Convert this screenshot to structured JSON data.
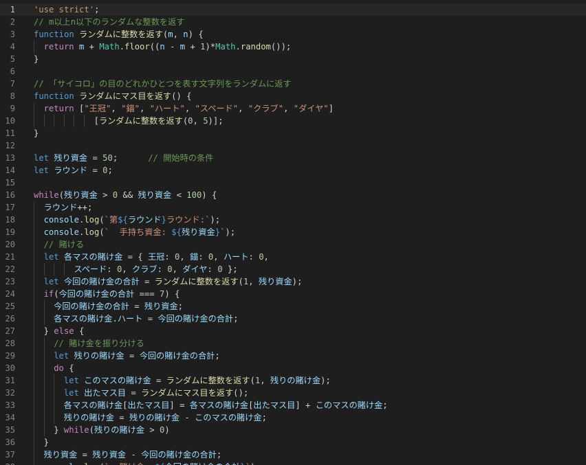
{
  "editor": {
    "active_line": 1,
    "colors": {
      "background": "#1e1e1e",
      "keyword": "#569cd6",
      "control": "#c586c0",
      "string": "#ce9178",
      "comment": "#6a9955",
      "number": "#b5cea8",
      "function": "#dcdcaa",
      "variable": "#9cdcfe",
      "class": "#4ec9b0",
      "punctuation": "#d4d4d4"
    },
    "lines": [
      {
        "n": "1",
        "indent": 0,
        "tokens": [
          [
            "str",
            "'use strict'"
          ],
          [
            "p",
            ";"
          ]
        ]
      },
      {
        "n": "2",
        "indent": 0,
        "tokens": [
          [
            "cmt",
            "// m以上n以下のランダムな整数を返す"
          ]
        ]
      },
      {
        "n": "3",
        "indent": 0,
        "tokens": [
          [
            "kw",
            "function"
          ],
          [
            "p",
            " "
          ],
          [
            "fn",
            "ランダムに整数を返す"
          ],
          [
            "p",
            "("
          ],
          [
            "var",
            "m"
          ],
          [
            "p",
            ", "
          ],
          [
            "var",
            "n"
          ],
          [
            "p",
            ") {"
          ]
        ]
      },
      {
        "n": "4",
        "indent": 1,
        "tokens": [
          [
            "ctl",
            "return"
          ],
          [
            "p",
            " "
          ],
          [
            "var",
            "m"
          ],
          [
            "p",
            " + "
          ],
          [
            "cls",
            "Math"
          ],
          [
            "p",
            "."
          ],
          [
            "fn",
            "floor"
          ],
          [
            "p",
            "(("
          ],
          [
            "var",
            "n"
          ],
          [
            "p",
            " - "
          ],
          [
            "var",
            "m"
          ],
          [
            "p",
            " + "
          ],
          [
            "num",
            "1"
          ],
          [
            "p",
            ")*"
          ],
          [
            "cls",
            "Math"
          ],
          [
            "p",
            "."
          ],
          [
            "fn",
            "random"
          ],
          [
            "p",
            "());"
          ]
        ]
      },
      {
        "n": "5",
        "indent": 0,
        "tokens": [
          [
            "p",
            "}"
          ]
        ]
      },
      {
        "n": "6",
        "indent": 0,
        "tokens": []
      },
      {
        "n": "7",
        "indent": 0,
        "tokens": [
          [
            "cmt",
            "// 「サイコロ」の目のどれかひとつを表す文字列をランダムに返す"
          ]
        ]
      },
      {
        "n": "8",
        "indent": 0,
        "tokens": [
          [
            "kw",
            "function"
          ],
          [
            "p",
            " "
          ],
          [
            "fn",
            "ランダムにマス目を返す"
          ],
          [
            "p",
            "() {"
          ]
        ]
      },
      {
        "n": "9",
        "indent": 1,
        "tokens": [
          [
            "ctl",
            "return"
          ],
          [
            "p",
            " ["
          ],
          [
            "str",
            "\"王冠\""
          ],
          [
            "p",
            ", "
          ],
          [
            "str",
            "\"錨\""
          ],
          [
            "p",
            ", "
          ],
          [
            "str",
            "\"ハート\""
          ],
          [
            "p",
            ", "
          ],
          [
            "str",
            "\"スペード\""
          ],
          [
            "p",
            ", "
          ],
          [
            "str",
            "\"クラブ\""
          ],
          [
            "p",
            ", "
          ],
          [
            "str",
            "\"ダイヤ\""
          ],
          [
            "p",
            "]"
          ]
        ]
      },
      {
        "n": "10",
        "indent": 6,
        "tokens": [
          [
            "p",
            "["
          ],
          [
            "fn",
            "ランダムに整数を返す"
          ],
          [
            "p",
            "("
          ],
          [
            "num",
            "0"
          ],
          [
            "p",
            ", "
          ],
          [
            "num",
            "5"
          ],
          [
            "p",
            ")];"
          ]
        ]
      },
      {
        "n": "11",
        "indent": 0,
        "tokens": [
          [
            "p",
            "}"
          ]
        ]
      },
      {
        "n": "12",
        "indent": 0,
        "tokens": []
      },
      {
        "n": "13",
        "indent": 0,
        "tokens": [
          [
            "kw",
            "let"
          ],
          [
            "p",
            " "
          ],
          [
            "var",
            "残り資金"
          ],
          [
            "p",
            " = "
          ],
          [
            "num",
            "50"
          ],
          [
            "p",
            ";      "
          ],
          [
            "cmt",
            "// 開始時の条件"
          ]
        ]
      },
      {
        "n": "14",
        "indent": 0,
        "tokens": [
          [
            "kw",
            "let"
          ],
          [
            "p",
            " "
          ],
          [
            "var",
            "ラウンド"
          ],
          [
            "p",
            " = "
          ],
          [
            "num",
            "0"
          ],
          [
            "p",
            ";"
          ]
        ]
      },
      {
        "n": "15",
        "indent": 0,
        "tokens": []
      },
      {
        "n": "16",
        "indent": 0,
        "tokens": [
          [
            "ctl",
            "while"
          ],
          [
            "p",
            "("
          ],
          [
            "var",
            "残り資金"
          ],
          [
            "p",
            " > "
          ],
          [
            "num",
            "0"
          ],
          [
            "p",
            " && "
          ],
          [
            "var",
            "残り資金"
          ],
          [
            "p",
            " < "
          ],
          [
            "num",
            "100"
          ],
          [
            "p",
            ") {"
          ]
        ]
      },
      {
        "n": "17",
        "indent": 1,
        "tokens": [
          [
            "var",
            "ラウンド"
          ],
          [
            "p",
            "++;"
          ]
        ]
      },
      {
        "n": "18",
        "indent": 1,
        "tokens": [
          [
            "var",
            "console"
          ],
          [
            "p",
            "."
          ],
          [
            "fn",
            "log"
          ],
          [
            "p",
            "("
          ],
          [
            "str",
            "`第"
          ],
          [
            "tpl",
            "${"
          ],
          [
            "var",
            "ラウンド"
          ],
          [
            "tpl",
            "}"
          ],
          [
            "str",
            "ラウンド:`"
          ],
          [
            "p",
            ");"
          ]
        ]
      },
      {
        "n": "19",
        "indent": 1,
        "tokens": [
          [
            "var",
            "console"
          ],
          [
            "p",
            "."
          ],
          [
            "fn",
            "log"
          ],
          [
            "p",
            "("
          ],
          [
            "str",
            "`  手持ち資金: "
          ],
          [
            "tpl",
            "${"
          ],
          [
            "var",
            "残り資金"
          ],
          [
            "tpl",
            "}"
          ],
          [
            "str",
            "`"
          ],
          [
            "p",
            ");"
          ]
        ]
      },
      {
        "n": "20",
        "indent": 1,
        "tokens": [
          [
            "cmt",
            "// 賭ける"
          ]
        ]
      },
      {
        "n": "21",
        "indent": 1,
        "tokens": [
          [
            "kw",
            "let"
          ],
          [
            "p",
            " "
          ],
          [
            "var",
            "各マスの賭け金"
          ],
          [
            "p",
            " = { "
          ],
          [
            "var",
            "王冠"
          ],
          [
            "p",
            ": "
          ],
          [
            "num",
            "0"
          ],
          [
            "p",
            ", "
          ],
          [
            "var",
            "錨"
          ],
          [
            "p",
            ": "
          ],
          [
            "num",
            "0"
          ],
          [
            "p",
            ", "
          ],
          [
            "var",
            "ハート"
          ],
          [
            "p",
            ": "
          ],
          [
            "num",
            "0"
          ],
          [
            "p",
            ","
          ]
        ]
      },
      {
        "n": "22",
        "indent": 4,
        "tokens": [
          [
            "var",
            "スペード"
          ],
          [
            "p",
            ": "
          ],
          [
            "num",
            "0"
          ],
          [
            "p",
            ", "
          ],
          [
            "var",
            "クラブ"
          ],
          [
            "p",
            ": "
          ],
          [
            "num",
            "0"
          ],
          [
            "p",
            ", "
          ],
          [
            "var",
            "ダイヤ"
          ],
          [
            "p",
            ": "
          ],
          [
            "num",
            "0"
          ],
          [
            "p",
            " };"
          ]
        ]
      },
      {
        "n": "23",
        "indent": 1,
        "tokens": [
          [
            "kw",
            "let"
          ],
          [
            "p",
            " "
          ],
          [
            "var",
            "今回の賭け金の合計"
          ],
          [
            "p",
            " = "
          ],
          [
            "fn",
            "ランダムに整数を返す"
          ],
          [
            "p",
            "("
          ],
          [
            "num",
            "1"
          ],
          [
            "p",
            ", "
          ],
          [
            "var",
            "残り資金"
          ],
          [
            "p",
            ");"
          ]
        ]
      },
      {
        "n": "24",
        "indent": 1,
        "tokens": [
          [
            "ctl",
            "if"
          ],
          [
            "p",
            "("
          ],
          [
            "var",
            "今回の賭け金の合計"
          ],
          [
            "p",
            " === "
          ],
          [
            "num",
            "7"
          ],
          [
            "p",
            ") {"
          ]
        ]
      },
      {
        "n": "25",
        "indent": 2,
        "tokens": [
          [
            "var",
            "今回の賭け金の合計"
          ],
          [
            "p",
            " = "
          ],
          [
            "var",
            "残り資金"
          ],
          [
            "p",
            ";"
          ]
        ]
      },
      {
        "n": "26",
        "indent": 2,
        "tokens": [
          [
            "var",
            "各マスの賭け金"
          ],
          [
            "p",
            "."
          ],
          [
            "var",
            "ハート"
          ],
          [
            "p",
            " = "
          ],
          [
            "var",
            "今回の賭け金の合計"
          ],
          [
            "p",
            ";"
          ]
        ]
      },
      {
        "n": "27",
        "indent": 1,
        "tokens": [
          [
            "p",
            "} "
          ],
          [
            "ctl",
            "else"
          ],
          [
            "p",
            " {"
          ]
        ]
      },
      {
        "n": "28",
        "indent": 2,
        "tokens": [
          [
            "cmt",
            "// 賭け金を振り分ける"
          ]
        ]
      },
      {
        "n": "29",
        "indent": 2,
        "tokens": [
          [
            "kw",
            "let"
          ],
          [
            "p",
            " "
          ],
          [
            "var",
            "残りの賭け金"
          ],
          [
            "p",
            " = "
          ],
          [
            "var",
            "今回の賭け金の合計"
          ],
          [
            "p",
            ";"
          ]
        ]
      },
      {
        "n": "30",
        "indent": 2,
        "tokens": [
          [
            "ctl",
            "do"
          ],
          [
            "p",
            " {"
          ]
        ]
      },
      {
        "n": "31",
        "indent": 3,
        "tokens": [
          [
            "kw",
            "let"
          ],
          [
            "p",
            " "
          ],
          [
            "var",
            "このマスの賭け金"
          ],
          [
            "p",
            " = "
          ],
          [
            "fn",
            "ランダムに整数を返す"
          ],
          [
            "p",
            "("
          ],
          [
            "num",
            "1"
          ],
          [
            "p",
            ", "
          ],
          [
            "var",
            "残りの賭け金"
          ],
          [
            "p",
            ");"
          ]
        ]
      },
      {
        "n": "32",
        "indent": 3,
        "tokens": [
          [
            "kw",
            "let"
          ],
          [
            "p",
            " "
          ],
          [
            "var",
            "出たマス目"
          ],
          [
            "p",
            " = "
          ],
          [
            "fn",
            "ランダムにマス目を返す"
          ],
          [
            "p",
            "();"
          ]
        ]
      },
      {
        "n": "33",
        "indent": 3,
        "tokens": [
          [
            "var",
            "各マスの賭け金"
          ],
          [
            "p",
            "["
          ],
          [
            "var",
            "出たマス目"
          ],
          [
            "p",
            "] = "
          ],
          [
            "var",
            "各マスの賭け金"
          ],
          [
            "p",
            "["
          ],
          [
            "var",
            "出たマス目"
          ],
          [
            "p",
            "] + "
          ],
          [
            "var",
            "このマスの賭け金"
          ],
          [
            "p",
            ";"
          ]
        ]
      },
      {
        "n": "34",
        "indent": 3,
        "tokens": [
          [
            "var",
            "残りの賭け金"
          ],
          [
            "p",
            " = "
          ],
          [
            "var",
            "残りの賭け金"
          ],
          [
            "p",
            " - "
          ],
          [
            "var",
            "このマスの賭け金"
          ],
          [
            "p",
            ";"
          ]
        ]
      },
      {
        "n": "35",
        "indent": 2,
        "tokens": [
          [
            "p",
            "} "
          ],
          [
            "ctl",
            "while"
          ],
          [
            "p",
            "("
          ],
          [
            "var",
            "残りの賭け金"
          ],
          [
            "p",
            " > "
          ],
          [
            "num",
            "0"
          ],
          [
            "p",
            ")"
          ]
        ]
      },
      {
        "n": "36",
        "indent": 1,
        "tokens": [
          [
            "p",
            "}"
          ]
        ]
      },
      {
        "n": "37",
        "indent": 1,
        "tokens": [
          [
            "var",
            "残り資金"
          ],
          [
            "p",
            " = "
          ],
          [
            "var",
            "残り資金"
          ],
          [
            "p",
            " - "
          ],
          [
            "var",
            "今回の賭け金の合計"
          ],
          [
            "p",
            ";"
          ]
        ]
      },
      {
        "n": "38",
        "indent": 1,
        "tokens": [
          [
            "var",
            "console"
          ],
          [
            "p",
            "."
          ],
          [
            "fn",
            "log"
          ],
          [
            "p",
            "("
          ],
          [
            "str",
            "`  賭け金: "
          ],
          [
            "tpl",
            "${"
          ],
          [
            "var",
            "今回の賭け金の合計"
          ],
          [
            "tpl",
            "}"
          ],
          [
            "str",
            "`"
          ],
          [
            "p",
            ");"
          ]
        ]
      }
    ]
  }
}
